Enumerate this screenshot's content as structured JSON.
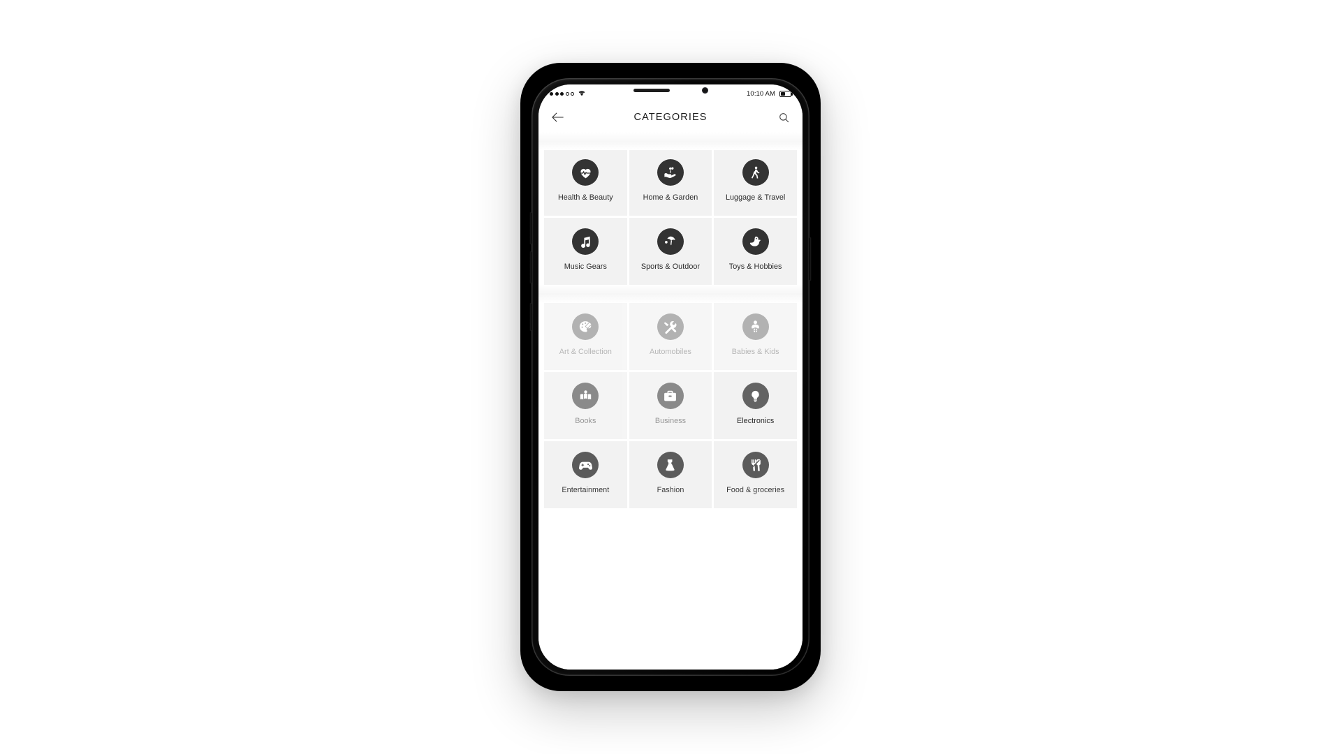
{
  "statusbar": {
    "signal_dots": [
      "filled",
      "filled",
      "filled",
      "hollow",
      "hollow"
    ],
    "wifi_icon": "wifi-icon",
    "time": "10:10 AM",
    "battery_icon": "battery-icon",
    "battery_level_pct": 45
  },
  "appbar": {
    "back_icon": "back-arrow-icon",
    "title": "CATEGORIES",
    "search_icon": "search-icon"
  },
  "theme": {
    "tile_background": "#f2f2f2",
    "page_background": "#ffffff",
    "badge_dark": "#333333",
    "badge_muted": "#848484",
    "text_primary": "#2b2b2b",
    "text_muted": "#8a8a8a"
  },
  "groups": [
    {
      "id": "group-1",
      "rows": [
        [
          {
            "label": "Health & Beauty",
            "icon": "heartbeat-icon",
            "state": "active"
          },
          {
            "label": "Home & Garden",
            "icon": "hand-plant-icon",
            "state": "active"
          },
          {
            "label": "Luggage & Travel",
            "icon": "traveler-walking-icon",
            "state": "active"
          }
        ],
        [
          {
            "label": "Music Gears",
            "icon": "music-note-icon",
            "state": "active"
          },
          {
            "label": "Sports & Outdoor",
            "icon": "beach-umbrella-icon",
            "state": "active"
          },
          {
            "label": "Toys & Hobbies",
            "icon": "rubber-duck-icon",
            "state": "active"
          }
        ]
      ]
    },
    {
      "id": "group-2",
      "rows": [
        [
          {
            "label": "Art & Collection",
            "icon": "paint-palette-icon",
            "state": "dim"
          },
          {
            "label": "Automobiles",
            "icon": "tools-icon",
            "state": "dim"
          },
          {
            "label": "Babies & Kids",
            "icon": "baby-icon",
            "state": "dim"
          }
        ],
        [
          {
            "label": "Books",
            "icon": "open-book-reader-icon",
            "state": "semi"
          },
          {
            "label": "Business",
            "icon": "briefcase-icon",
            "state": "semi"
          },
          {
            "label": "Electronics",
            "icon": "lightbulb-icon",
            "state": "strong"
          }
        ],
        [
          {
            "label": "Entertainment",
            "icon": "gamepad-icon",
            "state": "mid"
          },
          {
            "label": "Fashion",
            "icon": "dress-icon",
            "state": "mid"
          },
          {
            "label": "Food & groceries",
            "icon": "fork-knife-icon",
            "state": "mid"
          }
        ]
      ]
    }
  ]
}
